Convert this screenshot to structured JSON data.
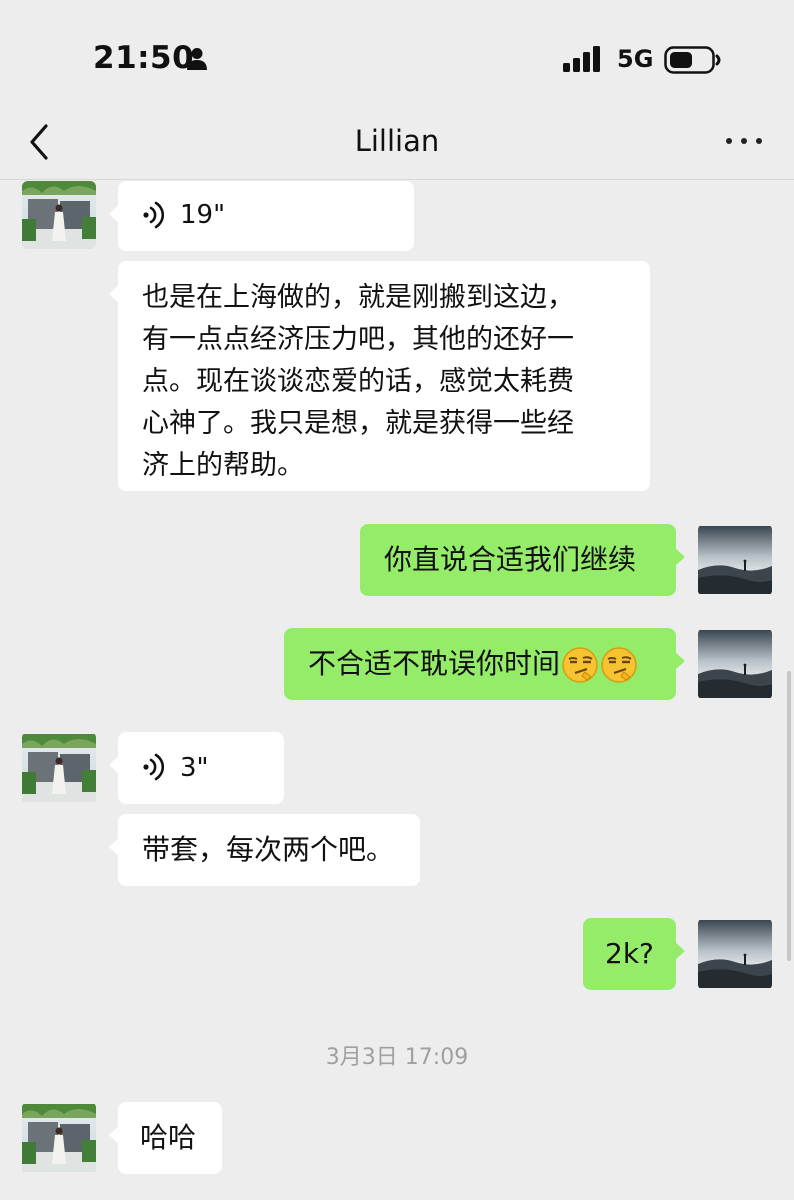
{
  "status_bar": {
    "time": "21:50",
    "network": "5G"
  },
  "header": {
    "title": "Lillian"
  },
  "messages": [
    {
      "side": "in",
      "type": "voice",
      "duration": "19\""
    },
    {
      "side": "in",
      "type": "text",
      "lines": [
        "也是在上海做的，就是刚搬到这边，",
        "有一点点经济压力吧，其他的还好一",
        "点。现在谈谈恋爱的话，感觉太耗费",
        "心神了。我只是想，就是获得一些经",
        "济上的帮助。"
      ]
    },
    {
      "side": "out",
      "type": "text",
      "text": "你直说合适我们继续"
    },
    {
      "side": "out",
      "type": "text",
      "text": "不合适不耽误你时间",
      "emojis": [
        "smirk-emoji",
        "smirk-emoji"
      ]
    },
    {
      "side": "in",
      "type": "voice",
      "duration": "3\""
    },
    {
      "side": "in",
      "type": "text",
      "text": "带套，每次两个吧。"
    },
    {
      "side": "out",
      "type": "text",
      "text": "2k?"
    },
    {
      "side": "system",
      "type": "timestamp",
      "text": "3月3日 17:09"
    },
    {
      "side": "in",
      "type": "text",
      "text": "哈哈"
    }
  ],
  "colors": {
    "background": "#ededed",
    "incoming_bubble": "#ffffff",
    "outgoing_bubble": "#95ec69",
    "timestamp": "#a0a0a0"
  },
  "icons": [
    "person-icon",
    "signal-icon",
    "battery-icon",
    "back-chevron-icon",
    "more-icon",
    "voice-wave-icon",
    "smirk-emoji"
  ]
}
